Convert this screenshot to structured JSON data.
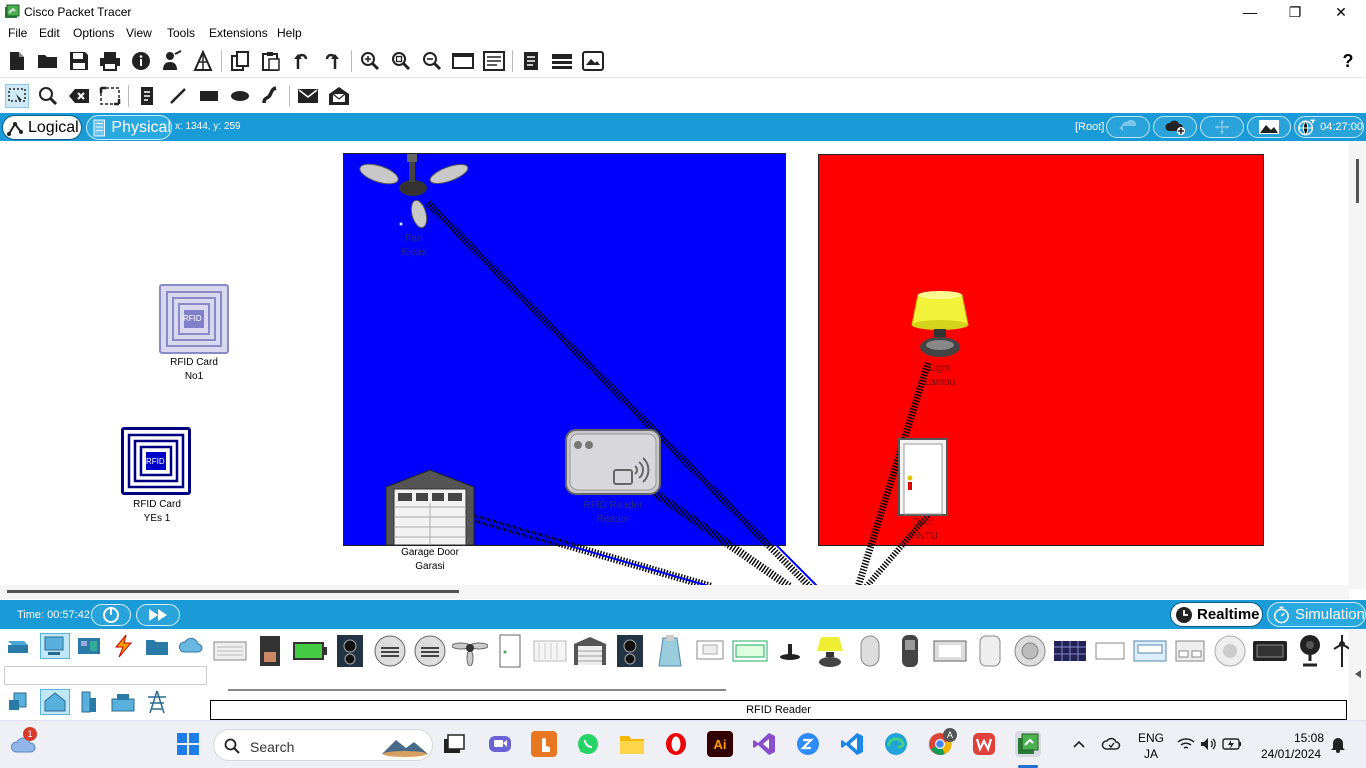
{
  "window": {
    "title": "Cisco Packet Tracer",
    "controls": {
      "minimize": "—",
      "maximize": "❐",
      "close": "✕"
    }
  },
  "menu": [
    "File",
    "Edit",
    "Options",
    "View",
    "Tools",
    "Extensions",
    "Help"
  ],
  "toolbar_main": {
    "icons": [
      "new-file-icon",
      "open-folder-icon",
      "save-icon",
      "print-icon",
      "info-icon",
      "activity-wizard-icon",
      "network-info-icon",
      "copy-icon",
      "paste-icon",
      "undo-icon",
      "redo-icon",
      "zoom-in-icon",
      "zoom-reset-icon",
      "zoom-out-icon",
      "drawing-palette-icon",
      "custom-device-icon",
      "notes-icon",
      "viewport-icon",
      "physical-workspace-icon"
    ],
    "help": "?"
  },
  "toolbar_tools": {
    "icons": [
      "select-icon",
      "inspect-icon",
      "delete-icon",
      "resize-shape-icon",
      "place-note-icon",
      "draw-line-icon",
      "draw-rectangle-icon",
      "draw-ellipse-icon",
      "draw-freeform-icon",
      "add-simple-pdu-icon",
      "add-complex-pdu-icon"
    ]
  },
  "workspace_bar": {
    "tab_logical": "Logical",
    "tab_physical": "Physical",
    "coords": "x: 1344, y: 259",
    "root": "[Root]",
    "clock": "04:27:00"
  },
  "colors": {
    "accent_blue": "#1a9ad6",
    "room_blue": "#0000ff",
    "room_red": "#ff0000"
  },
  "devices": {
    "rfid_card_1": {
      "line1": "RFID Card",
      "line2": "No1",
      "badge": "RFID"
    },
    "rfid_card_2": {
      "line1": "RFID Card",
      "line2": "YEs 1",
      "badge": "RFID"
    },
    "fan": {
      "line1": "Fan",
      "line2": "Kipas"
    },
    "garage_door": {
      "line1": "Garage Door",
      "line2": "Garasi"
    },
    "rfid_reader": {
      "line1": "RFID Reader",
      "line2": "Reader"
    },
    "light": {
      "line1": "Light",
      "line2": "Lampu"
    },
    "door": {
      "line1": "Door",
      "line2": "PINTU"
    }
  },
  "timebar": {
    "time": "Time: 00:57:42",
    "realtime": "Realtime",
    "simulation": "Simulation"
  },
  "palette": {
    "selected_device": "RFID Reader"
  },
  "taskbar": {
    "search": "Search",
    "notification_count": "1",
    "lang_line1": "ENG",
    "lang_line2": "JA",
    "time": "15:08",
    "date": "24/01/2024",
    "apps": [
      "file-explorer-thumb",
      "task-view-icon",
      "teams-icon",
      "store-icon",
      "whatsapp-icon",
      "folder-icon",
      "opera-icon",
      "illustrator-icon",
      "visual-studio-icon",
      "zoom-icon",
      "vscode-icon",
      "edge-icon",
      "chrome-icon",
      "wps-icon",
      "packet-tracer-icon"
    ],
    "ai_label": "Ai",
    "chrome_badge": "A"
  }
}
